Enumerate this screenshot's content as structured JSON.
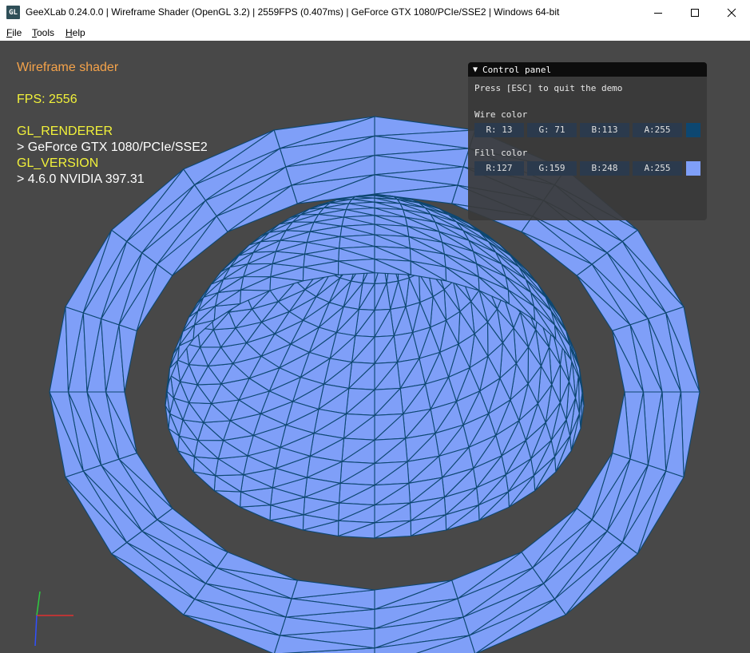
{
  "window": {
    "title": "GeeXLab 0.24.0.0 | Wireframe Shader (OpenGL 3.2) | 2559FPS (0.407ms) | GeForce GTX 1080/PCIe/SSE2 | Windows 64-bit",
    "icon_text": "GL",
    "controls": [
      "minimize-icon",
      "maximize-icon",
      "close-icon"
    ]
  },
  "menu": {
    "items": [
      {
        "key": "F",
        "rest": "ile"
      },
      {
        "key": "T",
        "rest": "ools"
      },
      {
        "key": "H",
        "rest": "elp"
      }
    ]
  },
  "hud": {
    "title": "Wireframe shader",
    "fps": "FPS: 2556",
    "renderer_label": "GL_RENDERER",
    "renderer_value": "> GeForce GTX 1080/PCIe/SSE2",
    "version_label": "GL_VERSION",
    "version_value": "> 4.6.0 NVIDIA 397.31"
  },
  "control_panel": {
    "title": "Control panel",
    "esc_text": "Press [ESC] to quit the demo",
    "wire_color": {
      "label": "Wire color",
      "fields": [
        "R: 13",
        "G: 71",
        "B:113",
        "A:255"
      ],
      "swatch": "#0d4771"
    },
    "fill_color": {
      "label": "Fill color",
      "fields": [
        "R:127",
        "G:159",
        "B:248",
        "A:255"
      ],
      "swatch": "#7f9ff8"
    }
  },
  "colors": {
    "viewport_bg": "#484848",
    "hud_title": "#f5a34a",
    "hud_text": "#f1f13a",
    "wire": "#0d4771",
    "fill": "#7f9ff8"
  }
}
